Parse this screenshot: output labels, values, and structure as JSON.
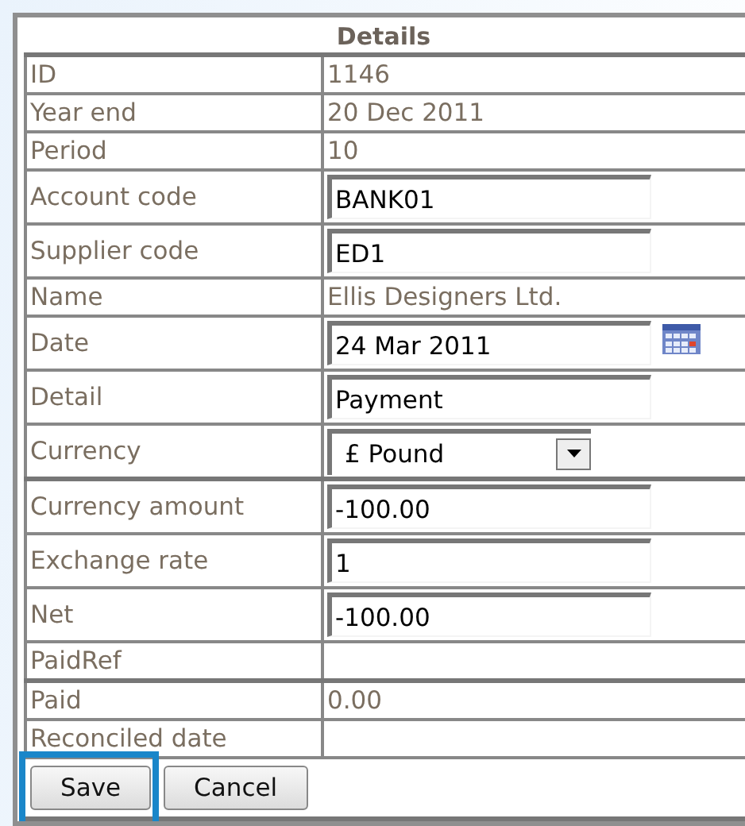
{
  "title": "Details",
  "groups": [
    {
      "rows": [
        {
          "label": "ID",
          "kind": "text",
          "value": "1146"
        },
        {
          "label": "Year end",
          "kind": "text",
          "value": "20 Dec 2011"
        },
        {
          "label": "Period",
          "kind": "text",
          "value": "10"
        },
        {
          "label": "Account code",
          "kind": "input",
          "value": "BANK01"
        },
        {
          "label": "Supplier code",
          "kind": "input",
          "value": "ED1"
        },
        {
          "label": "Name",
          "kind": "text",
          "value": "Ellis Designers Ltd."
        },
        {
          "label": "Date",
          "kind": "date",
          "value": "24 Mar 2011"
        },
        {
          "label": "Detail",
          "kind": "input",
          "value": "Payment"
        },
        {
          "label": "Currency",
          "kind": "select",
          "value": "£ Pound"
        }
      ]
    },
    {
      "rows": [
        {
          "label": "Currency amount",
          "kind": "input",
          "value": "-100.00"
        },
        {
          "label": "Exchange rate",
          "kind": "input",
          "value": "1"
        },
        {
          "label": "Net",
          "kind": "input",
          "value": "-100.00"
        },
        {
          "label": "PaidRef",
          "kind": "text"
        }
      ]
    },
    {
      "rows": [
        {
          "label": "Paid",
          "kind": "text",
          "value": "0.00"
        },
        {
          "label": "Reconciled date",
          "kind": "text"
        }
      ]
    }
  ],
  "buttons": [
    {
      "label": "Save",
      "highlighted": true
    },
    {
      "label": "Cancel",
      "highlighted": false
    }
  ]
}
